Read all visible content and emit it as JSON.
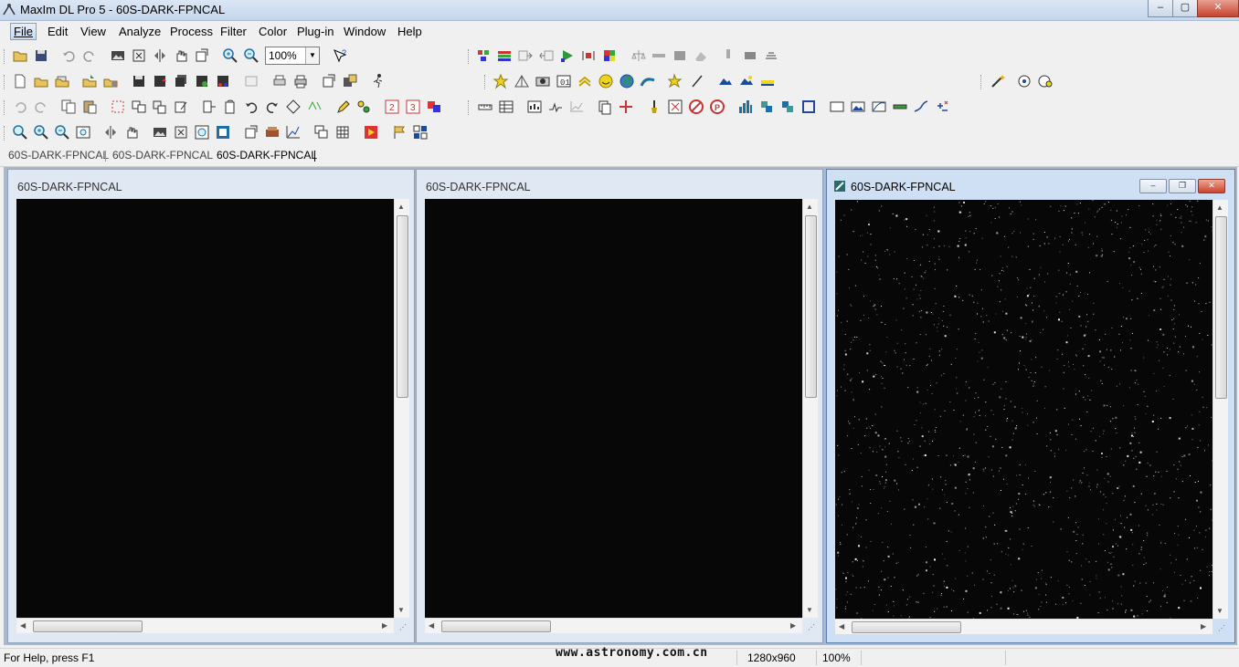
{
  "app": {
    "title": "MaxIm DL Pro 5 - 60S-DARK-FPNCAL",
    "window_controls": {
      "minimize": "–",
      "maximize": "▢",
      "close": "✕"
    }
  },
  "menubar": [
    {
      "label": "File",
      "active": true
    },
    {
      "label": "Edit"
    },
    {
      "label": "View"
    },
    {
      "label": "Analyze"
    },
    {
      "label": "Process"
    },
    {
      "label": "Filter"
    },
    {
      "label": "Color"
    },
    {
      "label": "Plug-in"
    },
    {
      "label": "Window"
    },
    {
      "label": "Help"
    }
  ],
  "toolbar": {
    "zoom_value": "100%"
  },
  "doc_tabs": [
    "60S-DARK-FPNCAL",
    "60S-DARK-FPNCAL",
    "60S-DARK-FPNCAL"
  ],
  "active_doc_tab": 2,
  "windows": [
    {
      "title": "60S-DARK-FPNCAL",
      "active": false
    },
    {
      "title": "60S-DARK-FPNCAL",
      "active": false
    },
    {
      "title": "60S-DARK-FPNCAL",
      "active": true
    }
  ],
  "statusbar": {
    "help": "For Help, press F1",
    "watermark": "www.astronomy.com.cn",
    "dimensions": "1280x960",
    "zoom": "100%"
  },
  "colors": {
    "title_gradient_top": "#dbe6f4",
    "canvas": "#070707",
    "active_window_border": "#5b7fae",
    "close_red": "#c7422c"
  }
}
